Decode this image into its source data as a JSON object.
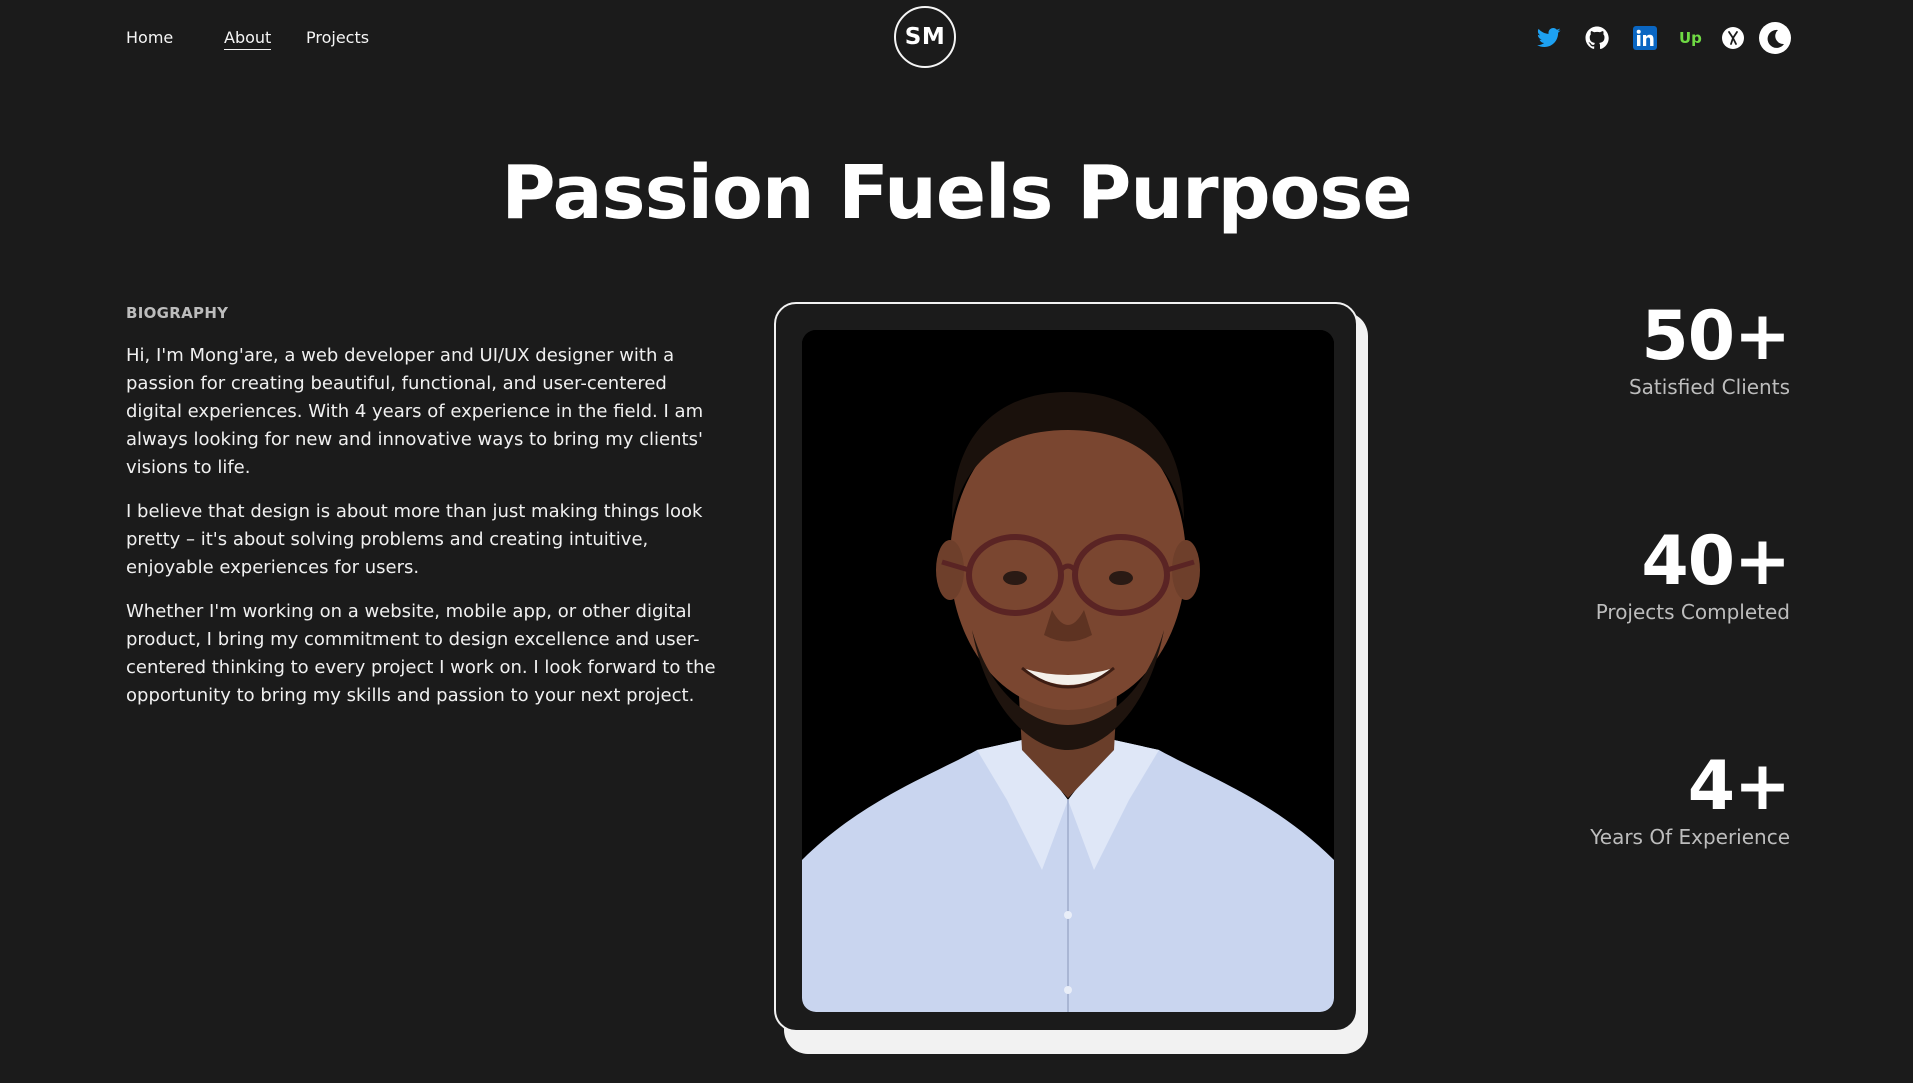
{
  "nav": {
    "links": [
      {
        "label": "Home"
      },
      {
        "label": "About"
      },
      {
        "label": "Projects"
      }
    ],
    "logo": "SM"
  },
  "social": {
    "icons": [
      "twitter-icon",
      "github-icon",
      "linkedin-icon",
      "upwork-icon",
      "dribbble-icon",
      "theme-toggle-icon"
    ],
    "colors": {
      "twitter": "#1da1f2",
      "github": "#ffffff",
      "linkedin": "#0a66c2",
      "upwork": "#6fda44"
    }
  },
  "hero": {
    "title": "Passion Fuels Purpose"
  },
  "biography": {
    "heading": "BIOGRAPHY",
    "paragraphs": [
      "Hi, I'm Mong'are, a web developer and UI/UX designer with a passion for creating beautiful, functional, and user-centered digital experiences. With 4 years of experience in the field. I am always looking for new and innovative ways to bring my clients' visions to life.",
      "I believe that design is about more than just making things look pretty – it's about solving problems and creating intuitive, enjoyable experiences for users.",
      "Whether I'm working on a website, mobile app, or other digital product, I bring my commitment to design excellence and user-centered thinking to every project I work on. I look forward to the opportunity to bring my skills and passion to your next project."
    ]
  },
  "stats": [
    {
      "value": "50+",
      "label": "Satisfied Clients"
    },
    {
      "value": "40+",
      "label": "Projects Completed"
    },
    {
      "value": "4+",
      "label": "Years Of Experience"
    }
  ],
  "theme": {
    "background": "#1b1b1b",
    "text": "#f5f5f5"
  }
}
